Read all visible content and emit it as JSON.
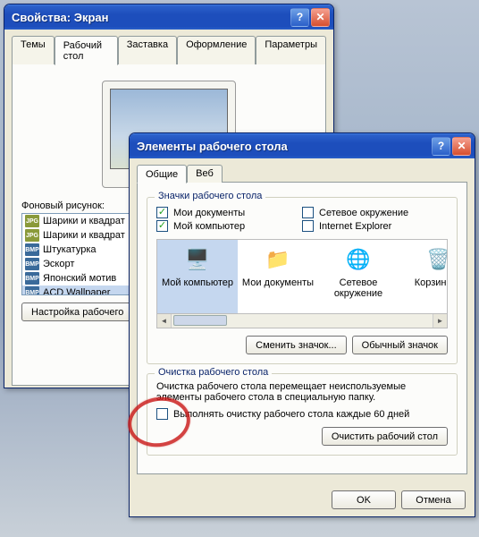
{
  "backWindow": {
    "title": "Свойства: Экран",
    "tabs": [
      "Темы",
      "Рабочий стол",
      "Заставка",
      "Оформление",
      "Параметры"
    ],
    "activeTab": 1,
    "backgroundLabel": "Фоновый рисунок:",
    "list": [
      {
        "type": "jpg",
        "name": "Шарики и квадрат"
      },
      {
        "type": "jpg",
        "name": "Шарики и квадрат"
      },
      {
        "type": "bmp",
        "name": "Штукатурка"
      },
      {
        "type": "bmp",
        "name": "Эскорт"
      },
      {
        "type": "bmp",
        "name": "Японский мотив"
      },
      {
        "type": "bmp",
        "name": "ACD Wallpaper"
      }
    ],
    "selectedIndex": 5,
    "customizeBtn": "Настройка рабочего"
  },
  "frontWindow": {
    "title": "Элементы рабочего стола",
    "tabs": [
      "Общие",
      "Веб"
    ],
    "activeTab": 0,
    "iconsGroup": {
      "legend": "Значки рабочего стола",
      "checks": [
        {
          "label": "Мои документы",
          "checked": true
        },
        {
          "label": "Мой компьютер",
          "checked": true
        },
        {
          "label": "Сетевое окружение",
          "checked": false
        },
        {
          "label": "Internet Explorer",
          "checked": false
        }
      ],
      "iconStrip": [
        {
          "label": "Мой компьютер",
          "glyph": "🖥️"
        },
        {
          "label": "Мои документы",
          "glyph": "📁"
        },
        {
          "label": "Сетевое окружение",
          "glyph": "🌐"
        },
        {
          "label": "Корзина (п",
          "glyph": "🗑️"
        }
      ],
      "selectedIcon": 0,
      "changeIconBtn": "Сменить значок...",
      "defaultIconBtn": "Обычный значок"
    },
    "cleanGroup": {
      "legend": "Очистка рабочего стола",
      "desc": "Очистка рабочего стола перемещает неиспользуемые элементы рабочего стола в специальную папку.",
      "cleanupCheck": {
        "label": "Выполнять очистку рабочего стола каждые 60 дней",
        "checked": false
      },
      "cleanNowBtn": "Очистить рабочий стол"
    },
    "okBtn": "OK",
    "cancelBtn": "Отмена"
  },
  "glyphs": {
    "help": "?",
    "close": "✕",
    "check": "✓",
    "left": "◄",
    "right": "►"
  },
  "iconTypeLabels": {
    "jpg": "JPG",
    "bmp": "BMP"
  }
}
